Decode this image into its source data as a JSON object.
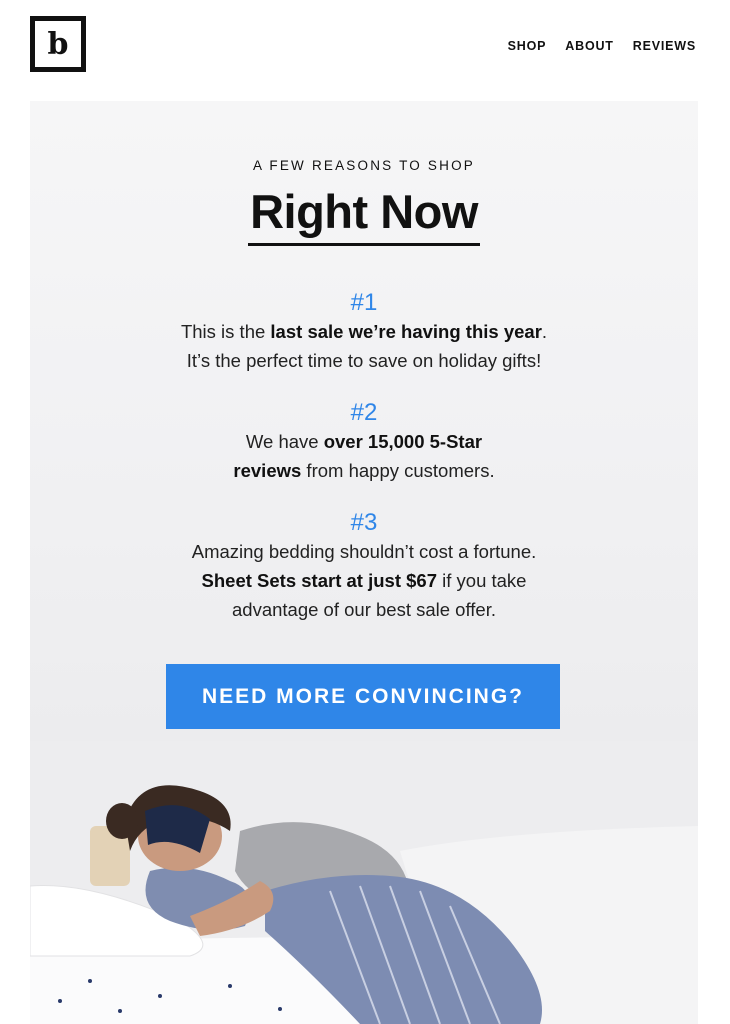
{
  "brand": {
    "logo_text": "b"
  },
  "nav": {
    "items": [
      "SHOP",
      "ABOUT",
      "REVIEWS"
    ]
  },
  "hero": {
    "eyebrow": "A FEW REASONS TO SHOP",
    "headline": "Right Now",
    "reasons": [
      {
        "number": "#1",
        "line1_pre": "This is the ",
        "line1_bold": "last sale we’re having this year",
        "line1_post": ".",
        "line2": "It’s the perfect time to save on holiday gifts!"
      },
      {
        "number": "#2",
        "line1_pre": "We have ",
        "line1_bold": "over 15,000 5-Star",
        "line2_bold": "reviews",
        "line2_post": " from happy customers."
      },
      {
        "number": "#3",
        "line1": "Amazing bedding shouldn’t cost a fortune.",
        "line2_bold": "Sheet Sets start at just $67",
        "line2_post": " if you take",
        "line3": "advantage of our best sale offer."
      }
    ],
    "cta_label": "NEED MORE CONVINCING?"
  },
  "colors": {
    "accent": "#2f86e8",
    "text": "#111111",
    "hero_bg": "#f0f0f2"
  }
}
